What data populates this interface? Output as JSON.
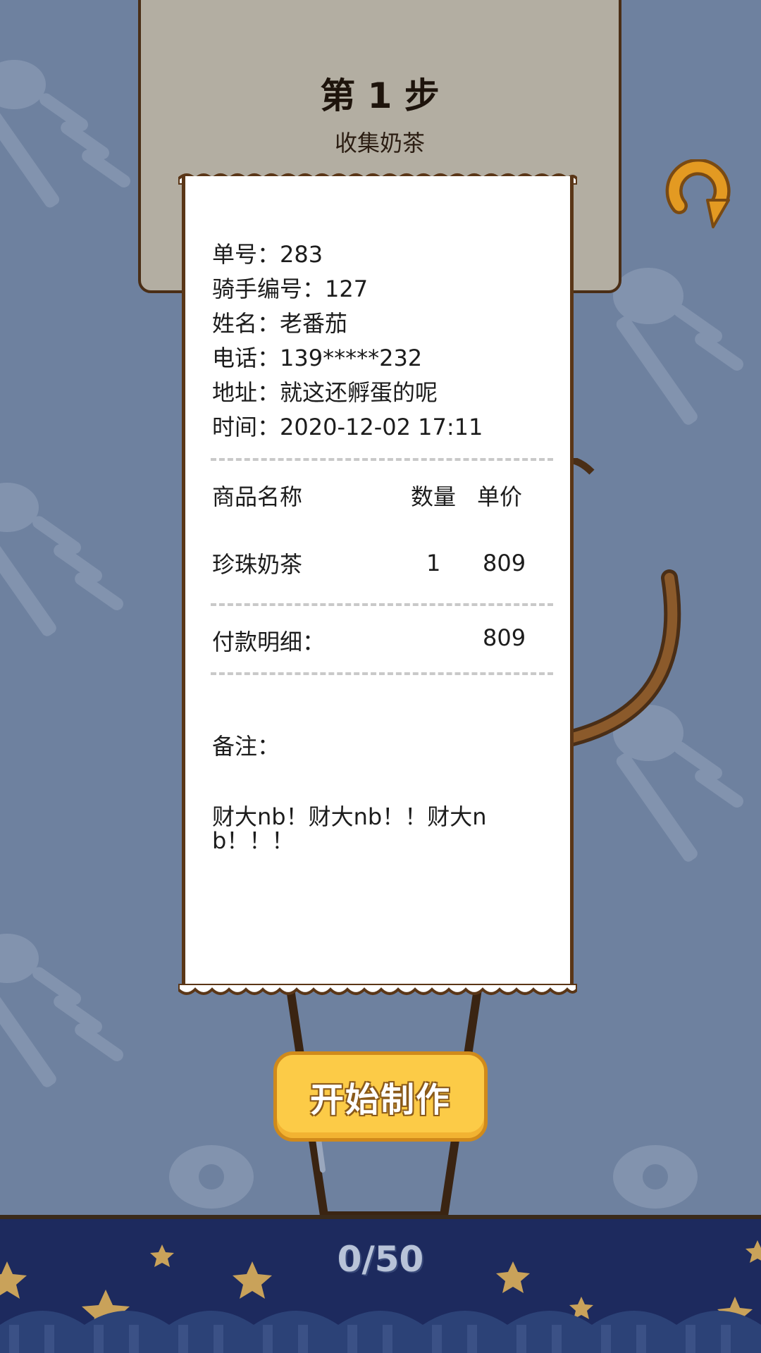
{
  "step": {
    "title": "第 1 步",
    "subtitle": "收集奶茶"
  },
  "receipt": {
    "order_no": "单号：283",
    "rider_no": "骑手编号：127",
    "name": "姓名：老番茄",
    "phone": "电话：139*****232",
    "address": "地址：就这还孵蛋的呢",
    "time": "时间：2020-12-02 17:11",
    "headers": {
      "product": "商品名称",
      "qty": "数量",
      "price": "单价"
    },
    "item": {
      "name": "珍珠奶茶",
      "qty": "1",
      "price": "809"
    },
    "payment_label": "付款明细：",
    "payment_total": "809",
    "remark_label": "备注：",
    "remark_text": "财大nb！财大nb！！财大nb！！！"
  },
  "start_button": {
    "label": "开始制作"
  },
  "progress": {
    "text": "0/50"
  },
  "icons": {
    "restart": "restart-arrow-icon",
    "background": "fishbone-icon",
    "stars": "star-icon",
    "moon": "moon-icon"
  },
  "colors": {
    "background": "#6e819f",
    "button": "#fccb47",
    "bottom_bar": "#1d2a5e",
    "outline": "#4a2e16"
  }
}
